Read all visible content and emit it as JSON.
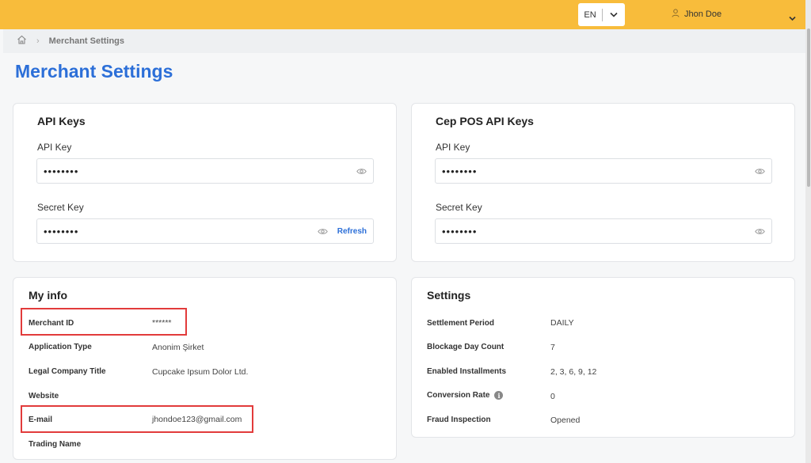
{
  "header": {
    "language": "EN",
    "user_name": "Jhon Doe"
  },
  "breadcrumb": {
    "current": "Merchant Settings",
    "separator": "›"
  },
  "page": {
    "title": "Merchant Settings"
  },
  "api_keys": {
    "title": "API Keys",
    "api_key_label": "API Key",
    "api_key_value": "••••••••",
    "secret_key_label": "Secret Key",
    "secret_key_value": "••••••••",
    "refresh_label": "Refresh"
  },
  "cep_pos_keys": {
    "title": "Cep POS API Keys",
    "api_key_label": "API Key",
    "api_key_value": "••••••••",
    "secret_key_label": "Secret Key",
    "secret_key_value": "••••••••"
  },
  "my_info": {
    "title": "My info",
    "rows": [
      {
        "label": "Merchant ID",
        "value": "******"
      },
      {
        "label": "Application Type",
        "value": "Anonim Şirket"
      },
      {
        "label": "Legal Company Title",
        "value": "Cupcake Ipsum Dolor Ltd."
      },
      {
        "label": "Website",
        "value": ""
      },
      {
        "label": "E-mail",
        "value": "jhondoe123@gmail.com"
      },
      {
        "label": "Trading Name",
        "value": ""
      }
    ]
  },
  "settings": {
    "title": "Settings",
    "info_icon_glyph": "i",
    "rows": [
      {
        "label": "Settlement Period",
        "value": "DAILY"
      },
      {
        "label": "Blockage Day Count",
        "value": "7"
      },
      {
        "label": "Enabled Installments",
        "value": "2, 3, 6, 9, 12"
      },
      {
        "label": "Conversion Rate",
        "value": "0"
      },
      {
        "label": "Fraud Inspection",
        "value": "Opened"
      }
    ]
  },
  "icons": {
    "home": "home-icon",
    "eye": "eye-icon",
    "chevron": "chevron-down-icon",
    "user": "user-icon",
    "info": "info-icon"
  },
  "colors": {
    "topbar": "#f8bc3b",
    "title_blue": "#2c6fd8",
    "highlight_red": "#e23b3b"
  }
}
